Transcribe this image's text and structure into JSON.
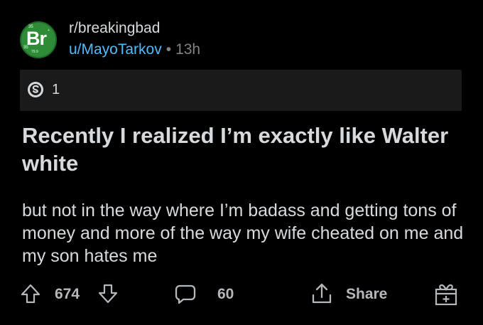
{
  "post": {
    "subreddit": "r/breakingbad",
    "author": "u/MayoTarkov",
    "separator": "•",
    "age": "13h",
    "avatar": {
      "symbol": "Br",
      "top_left_number": "35",
      "left_number": "35",
      "bottom_number": "79.9",
      "corner_mark": "+"
    },
    "awards_count": "1",
    "title": "Recently I realized I’m exactly like Walter white",
    "body": "but not in the way where I’m badass and getting tons of money and more of the way my wife cheated on me and my son hates me"
  },
  "actions": {
    "score": "674",
    "comments": "60",
    "share_label": "Share"
  },
  "colors": {
    "background": "#000000",
    "text": "#d7dadc",
    "username": "#4fbcff",
    "muted": "#818384",
    "award_bar": "#1a1a1b",
    "avatar_green": "#2e8b36"
  },
  "icons": {
    "award": "silver-award-icon",
    "upvote": "upvote-arrow-icon",
    "downvote": "downvote-arrow-icon",
    "comment": "comment-bubble-icon",
    "share": "share-upload-icon",
    "give_award": "gift-award-icon"
  }
}
